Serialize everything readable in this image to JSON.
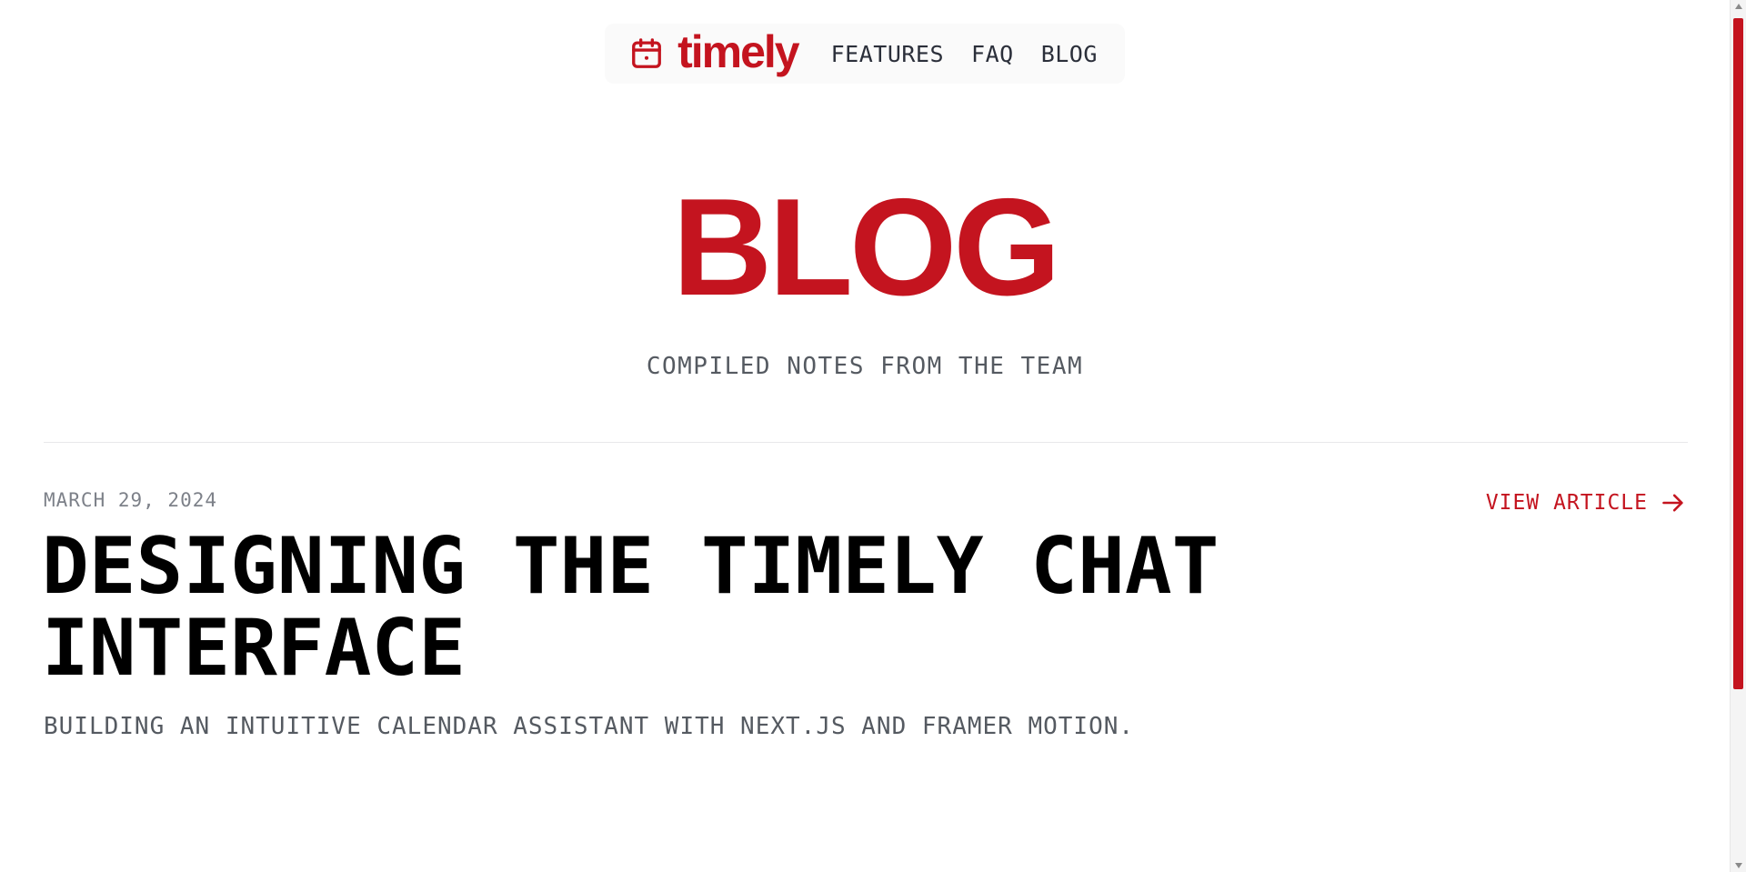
{
  "header": {
    "brand": "timely",
    "logo_icon": "calendar-icon",
    "nav": [
      {
        "label": "FEATURES"
      },
      {
        "label": "FAQ"
      },
      {
        "label": "BLOG"
      }
    ]
  },
  "hero": {
    "title": "BLOG",
    "subtitle": "COMPILED NOTES FROM THE TEAM"
  },
  "articles": [
    {
      "date": "MARCH 29, 2024",
      "title": "DESIGNING THE TIMELY CHAT INTERFACE",
      "description": "BUILDING AN INTUITIVE CALENDAR ASSISTANT WITH NEXT.JS AND FRAMER MOTION.",
      "link_label": "VIEW ARTICLE",
      "link_icon": "arrow-right-icon"
    }
  ],
  "theme": {
    "accent": "#c4141f",
    "text_dark": "#000000",
    "text_muted": "#555a61",
    "nav_text": "#2b2f3a"
  },
  "scrollbar": {
    "thumb_color": "#c4141f"
  }
}
